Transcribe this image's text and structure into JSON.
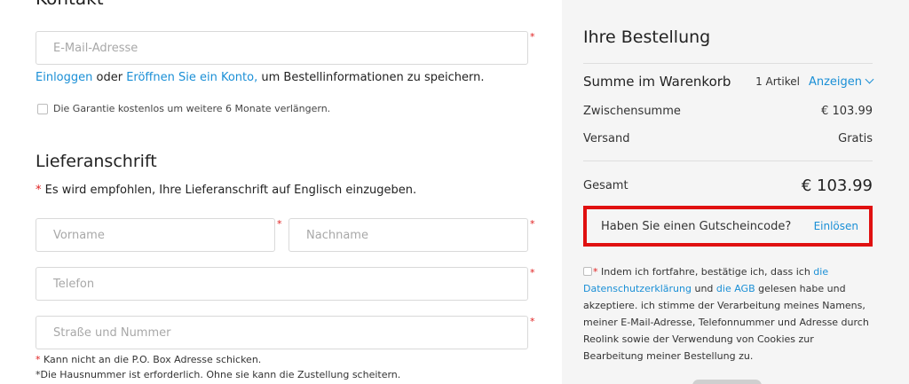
{
  "contact": {
    "heading": "Kontakt",
    "email_placeholder": "E-Mail-Adresse",
    "login_link": "Einloggen",
    "login_or": " oder ",
    "register_link": "Eröffnen Sie ein Konto,",
    "login_suffix": " um Bestellinformationen zu speichern.",
    "warranty_label": "Die Garantie kostenlos um weitere 6 Monate verlängern."
  },
  "shipping": {
    "heading": "Lieferanschrift",
    "hint_star": "*",
    "hint": " Es wird empfohlen, Ihre Lieferanschrift auf Englisch einzugeben.",
    "firstname_placeholder": "Vorname",
    "lastname_placeholder": "Nachname",
    "phone_placeholder": "Telefon",
    "street_placeholder": "Straße und Nummer",
    "note_pobox_star": "*",
    "note_pobox": " Kann nicht an die P.O. Box Adresse schicken.",
    "note_housenumber": "*Die Hausnummer ist erforderlich. Ohne sie kann die Zustellung scheitern."
  },
  "required_mark": "*",
  "order": {
    "heading": "Ihre Bestellung",
    "cart_label": "Summe im Warenkorb",
    "item_count": "1 Artikel",
    "show_link": "Anzeigen",
    "subtotal_label": "Zwischensumme",
    "subtotal_value": "€ 103.99",
    "shipping_label": "Versand",
    "shipping_value": "Gratis",
    "total_label": "Gesamt",
    "total_value": "€ 103.99",
    "coupon_question": "Haben Sie einen Gutscheincode?",
    "coupon_link": "Einlösen",
    "consent_star": "*",
    "consent_part1": " Indem ich fortfahre, bestätige ich, dass ich ",
    "consent_link1": "die Datenschutzerklärung",
    "consent_part2": " und ",
    "consent_link2": "die AGB",
    "consent_part3": " gelesen habe und akzeptiere. ich stimme der Verarbeitung meines Namens, meiner E-Mail-Adresse, Telefonnummer und Adresse durch Reolink sowie der Verwendung von Cookies zur Bearbeitung meiner Bestellung zu."
  },
  "colors": {
    "link": "#1a8fd6",
    "required": "#e02020",
    "highlight_border": "#e01010",
    "panel_bg": "#f5f5f5"
  },
  "icons": {
    "show_toggle": "chevron-down-icon"
  }
}
